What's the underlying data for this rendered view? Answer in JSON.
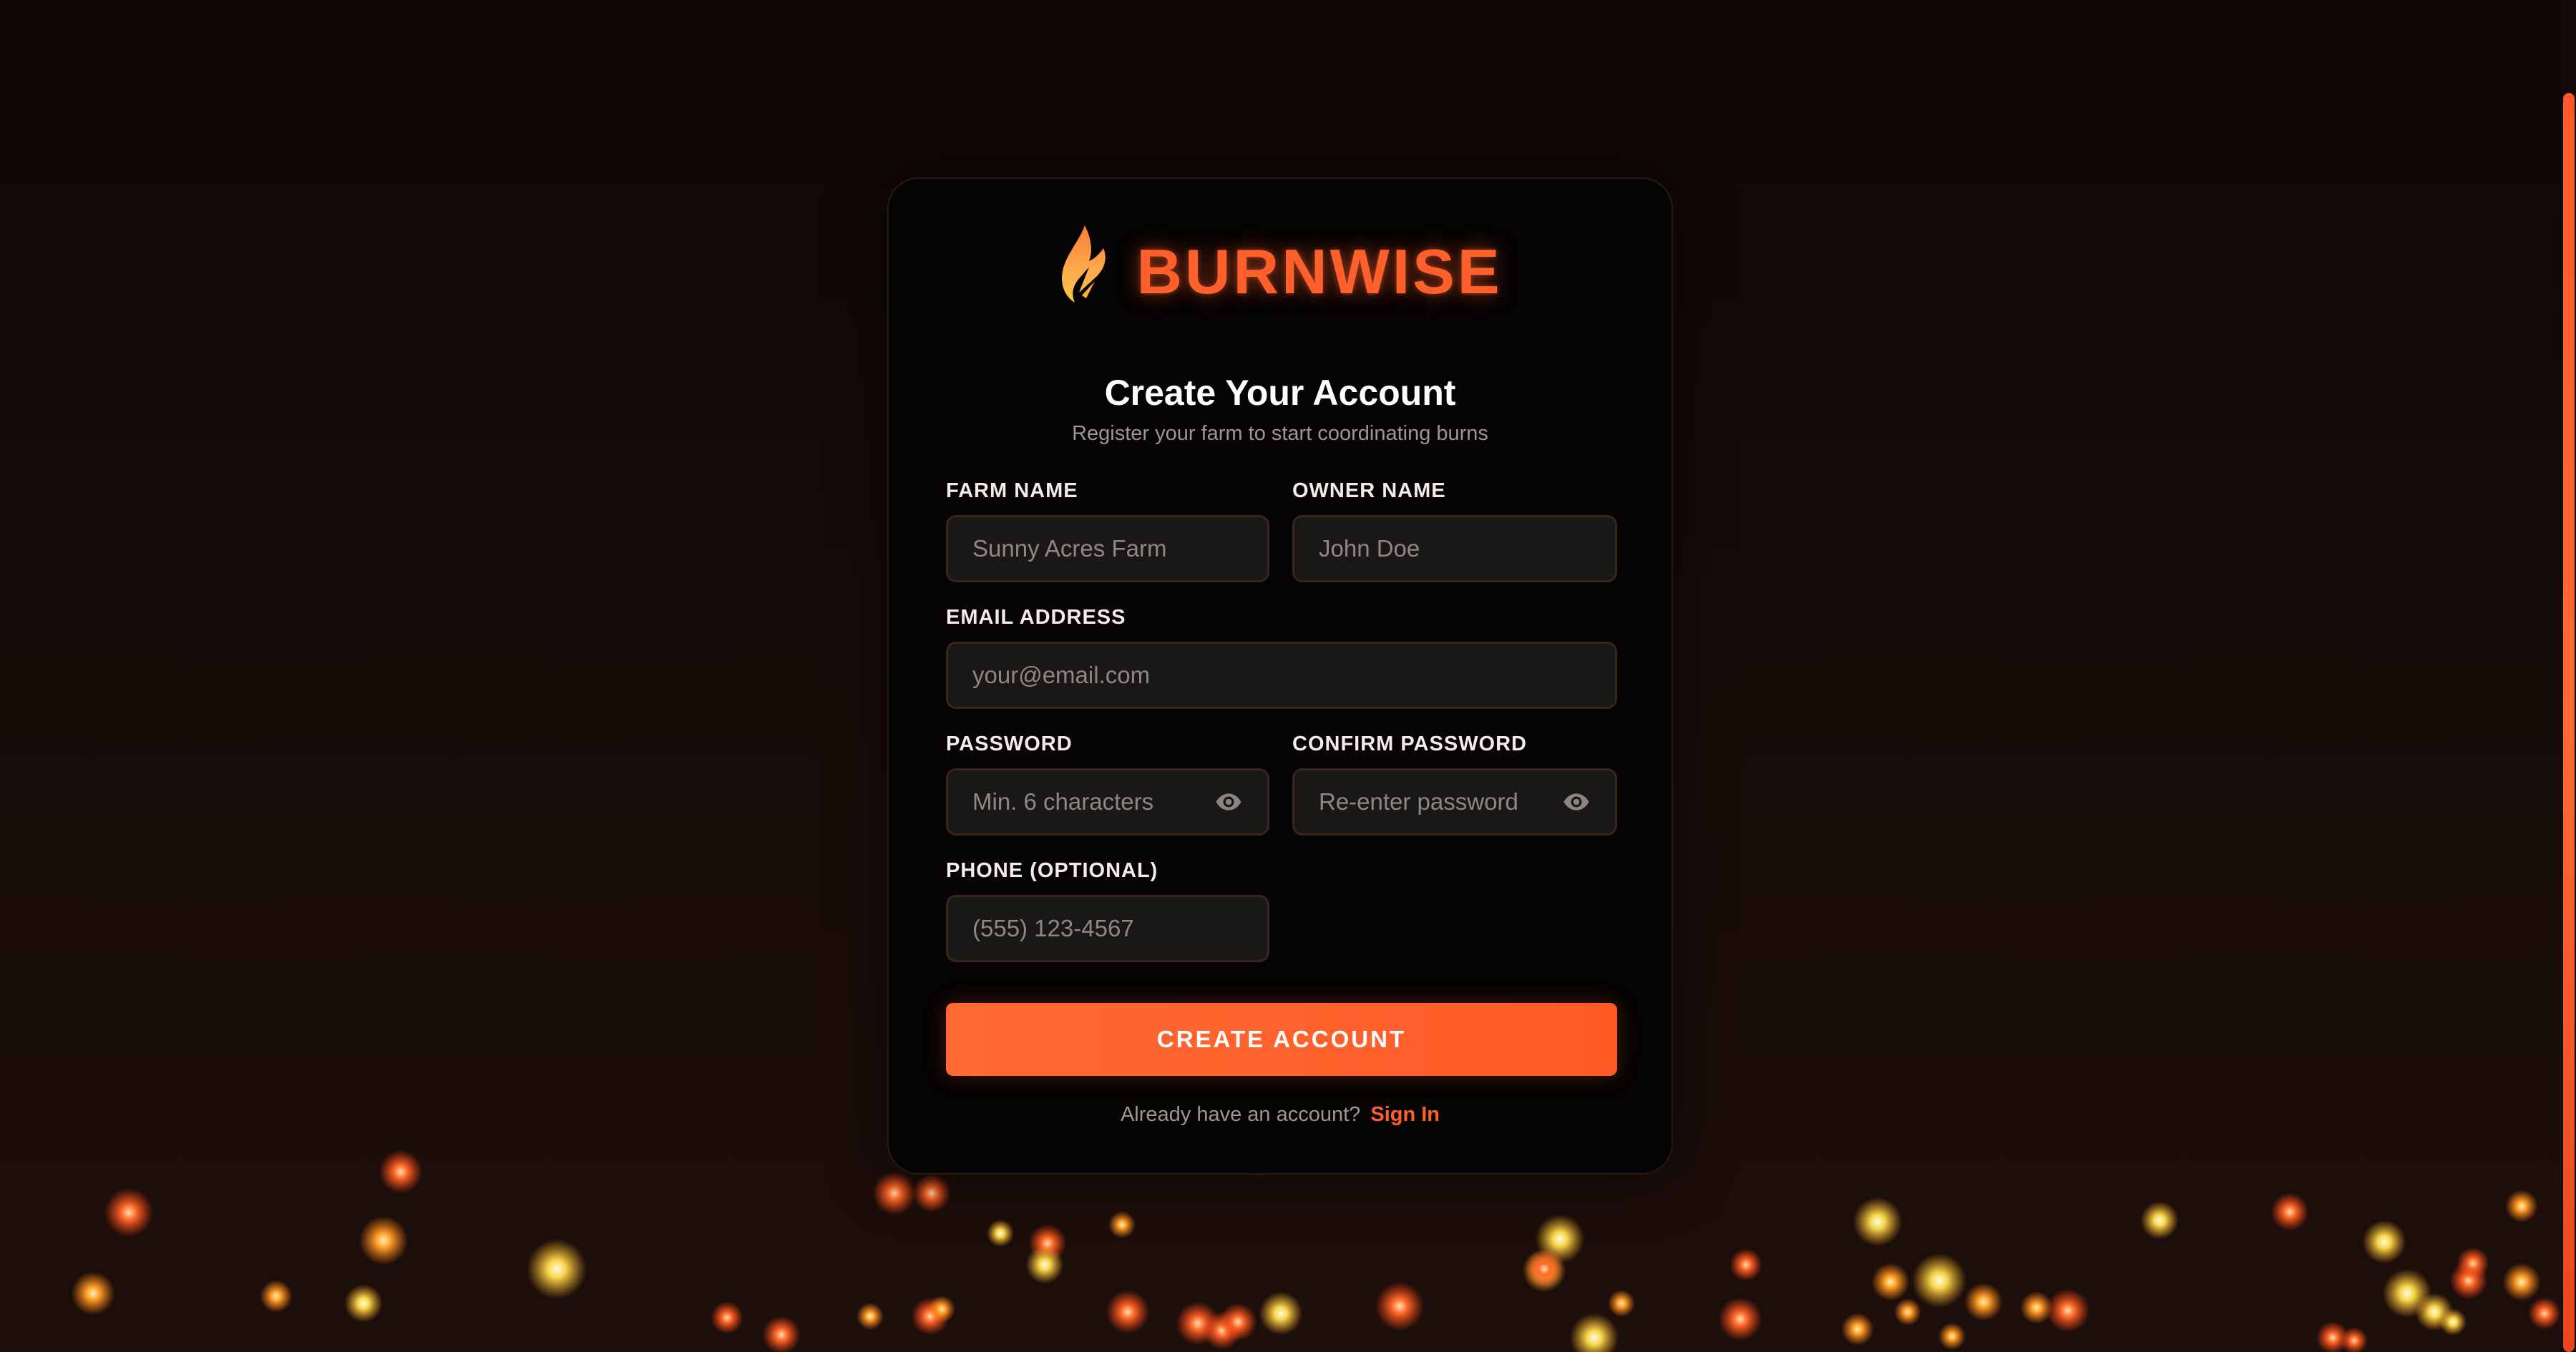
{
  "brand": {
    "name": "BURNWISE",
    "logo_icon": "flame-icon",
    "accent_color": "#ff5f2b"
  },
  "heading": {
    "title": "Create Your Account",
    "subtitle": "Register your farm to start coordinating burns"
  },
  "form": {
    "farm_name": {
      "label": "FARM NAME",
      "placeholder": "Sunny Acres Farm",
      "value": ""
    },
    "owner_name": {
      "label": "OWNER NAME",
      "placeholder": "John Doe",
      "value": ""
    },
    "email": {
      "label": "EMAIL ADDRESS",
      "placeholder": "your@email.com",
      "value": ""
    },
    "password": {
      "label": "PASSWORD",
      "placeholder": "Min. 6 characters",
      "value": "",
      "toggle_icon": "eye-icon"
    },
    "confirm_password": {
      "label": "CONFIRM PASSWORD",
      "placeholder": "Re-enter password",
      "value": "",
      "toggle_icon": "eye-icon"
    },
    "phone": {
      "label": "PHONE (OPTIONAL)",
      "placeholder": "(555) 123-4567",
      "value": ""
    },
    "submit_label": "CREATE ACCOUNT"
  },
  "footer": {
    "prompt": "Already have an account?",
    "link_label": "Sign In"
  }
}
